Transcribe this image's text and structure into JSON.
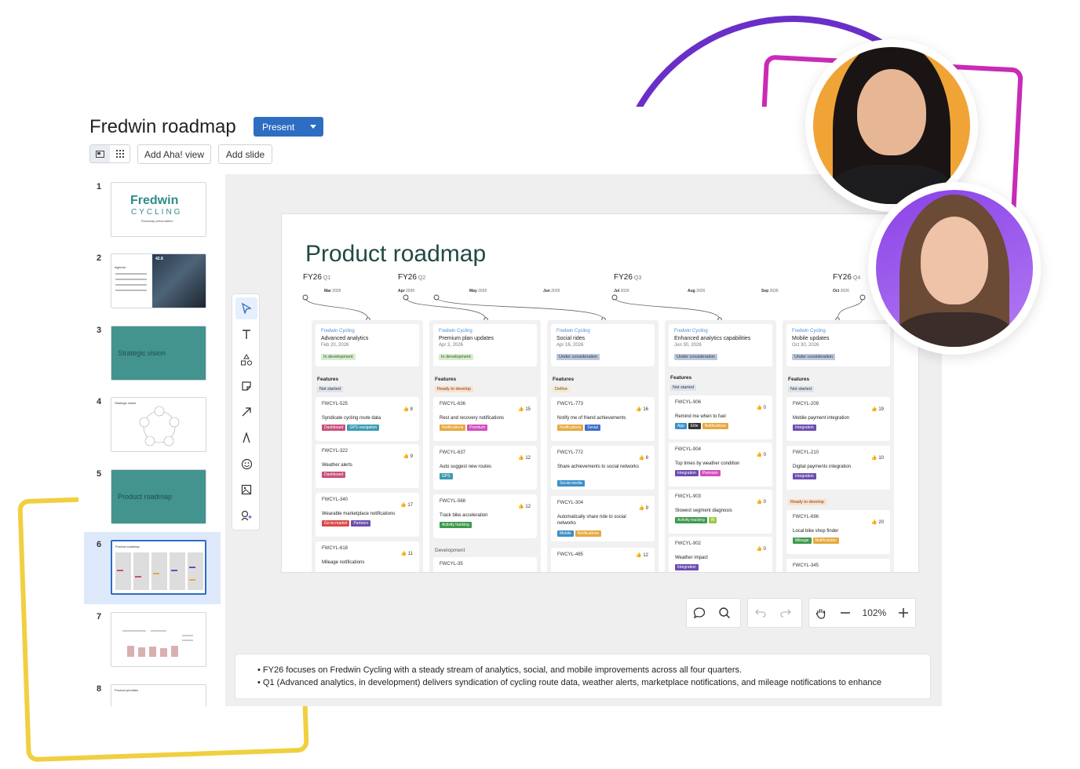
{
  "app": {
    "title": "Fredwin roadmap",
    "present_label": "Present",
    "add_aha_view_label": "Add Aha! view",
    "add_slide_label": "Add slide"
  },
  "slides": [
    {
      "num": "1",
      "logo_line1": "Fredwin",
      "logo_line2": "CYCLING",
      "sub": "Roadmap presentation"
    },
    {
      "num": "2",
      "heading": "Agenda",
      "chip": "42.8"
    },
    {
      "num": "3",
      "label": "Strategic vision"
    },
    {
      "num": "4",
      "heading": "Strategic vision"
    },
    {
      "num": "5",
      "label": "Product roadmap"
    },
    {
      "num": "6",
      "heading": "Product roadmap"
    },
    {
      "num": "7"
    },
    {
      "num": "8",
      "heading": "Product priorities"
    }
  ],
  "roadmap": {
    "title": "Product roadmap",
    "quarters": [
      {
        "fy": "FY26",
        "q": "Q1"
      },
      {
        "fy": "FY26",
        "q": "Q2"
      },
      {
        "fy": "FY26",
        "q": "Q3"
      },
      {
        "fy": "FY26",
        "q": "Q4"
      }
    ],
    "months": [
      {
        "m": "Mar",
        "y": "2026"
      },
      {
        "m": "Apr",
        "y": "2026"
      },
      {
        "m": "May",
        "y": "2026"
      },
      {
        "m": "Jun",
        "y": "2026"
      },
      {
        "m": "Jul",
        "y": "2026"
      },
      {
        "m": "Aug",
        "y": "2026"
      },
      {
        "m": "Sep",
        "y": "2026"
      },
      {
        "m": "Oct",
        "y": "2026"
      }
    ],
    "features_label": "Features",
    "columns": [
      {
        "brand": "Fredwin Cycling",
        "title": "Advanced analytics",
        "date": "Feb 20, 2026",
        "status": "In development",
        "feature_status": "Not started",
        "features": [
          {
            "id": "FWCYL-525",
            "score": "8",
            "name": "Syndicate cycling route data",
            "tags": [
              "Dashboard",
              "GPS navigation"
            ]
          },
          {
            "id": "FWCYL-322",
            "score": "9",
            "name": "Weather alerts",
            "tags": [
              "Dashboard"
            ]
          },
          {
            "id": "FWCYL-340",
            "score": "17",
            "name": "Wearable marketplace notifications",
            "tags": [
              "Go-to-market",
              "Partners"
            ]
          },
          {
            "id": "FWCYL-618",
            "score": "11",
            "name": "Mileage notifications",
            "tags": []
          }
        ]
      },
      {
        "brand": "Fredwin Cycling",
        "title": "Premium plan updates",
        "date": "Apr 3, 2026",
        "status": "In development",
        "feature_status": "Ready to develop",
        "features": [
          {
            "id": "FWCYL-636",
            "score": "15",
            "name": "Rest and recovery notifications",
            "tags": [
              "Notifications",
              "Premium"
            ]
          },
          {
            "id": "FWCYL-637",
            "score": "12",
            "name": "Auto suggest new routes",
            "tags": [
              "GPS"
            ]
          },
          {
            "id": "FWCYL-568",
            "score": "12",
            "name": "Track bike acceleration",
            "tags": [
              "Activity tracking"
            ]
          }
        ],
        "extra_section": "Development",
        "extra_feature_id": "FWCYL-35"
      },
      {
        "brand": "Fredwin Cycling",
        "title": "Social rides",
        "date": "Apr 16, 2026",
        "status": "Under consideration",
        "feature_status": "Define",
        "features": [
          {
            "id": "FWCYL-773",
            "score": "16",
            "name": "Notify me of friend achievements",
            "tags": [
              "Notifications",
              "Social"
            ]
          },
          {
            "id": "FWCYL-772",
            "score": "8",
            "name": "Share achievements to social networks",
            "tags": [
              "Social media"
            ]
          },
          {
            "id": "FWCYL-304",
            "score": "9",
            "name": "Automatically share ride to social networks",
            "tags": [
              "Mobile",
              "Notifications"
            ]
          },
          {
            "id": "FWCYL-485",
            "score": "12",
            "name": "",
            "tags": []
          }
        ]
      },
      {
        "brand": "Fredwin Cycling",
        "title": "Enhanced analytics capabilities",
        "date": "Jun 30, 2026",
        "status": "Under consideration",
        "feature_status": "Not started",
        "features": [
          {
            "id": "FWCYL-906",
            "score": "0",
            "name": "Remind me when to fuel",
            "tags": [
              "App",
              "Elite",
              "Notifications"
            ]
          },
          {
            "id": "FWCYL-904",
            "score": "0",
            "name": "Top times by weather condition",
            "tags": [
              "Integration",
              "Premium"
            ]
          },
          {
            "id": "FWCYL-903",
            "score": "0",
            "name": "Slowest segment diagnosis",
            "tags": [
              "Activity tracking",
              "AI"
            ]
          },
          {
            "id": "FWCYL-902",
            "score": "0",
            "name": "Weather impact",
            "tags": [
              "Integration"
            ]
          }
        ]
      },
      {
        "brand": "Fredwin Cycling",
        "title": "Mobile updates",
        "date": "Oct 30, 2026",
        "status": "Under consideration",
        "feature_status": "Not started",
        "features": [
          {
            "id": "FWCYL-209",
            "score": "19",
            "name": "Mobile payment integration",
            "tags": [
              "Integration"
            ]
          },
          {
            "id": "FWCYL-210",
            "score": "10",
            "name": "Digital payments integration",
            "tags": [
              "Integration"
            ]
          },
          {
            "id": "FWCYL-696",
            "score": "20",
            "name": "Local bike shop finder",
            "tags": [
              "Mileage",
              "Notifications"
            ]
          },
          {
            "id": "FWCYL-345",
            "score": "",
            "name": "",
            "tags": []
          }
        ],
        "mid_status": "Ready to develop"
      }
    ]
  },
  "zoom": {
    "level": "102%"
  },
  "notes": [
    "FY26 focuses on Fredwin Cycling with a steady stream of analytics, social, and mobile improvements across all four quarters.",
    "Q1 (Advanced analytics, in development) delivers syndication of cycling route data, weather alerts, marketplace notifications, and mileage notifications to enhance"
  ],
  "colors": {
    "accent": "#2d6dc2",
    "teal": "#43938f",
    "purple_arc": "#6a2fc8",
    "pink_frame": "#c92bb6",
    "yellow_frame": "#f0d040"
  }
}
